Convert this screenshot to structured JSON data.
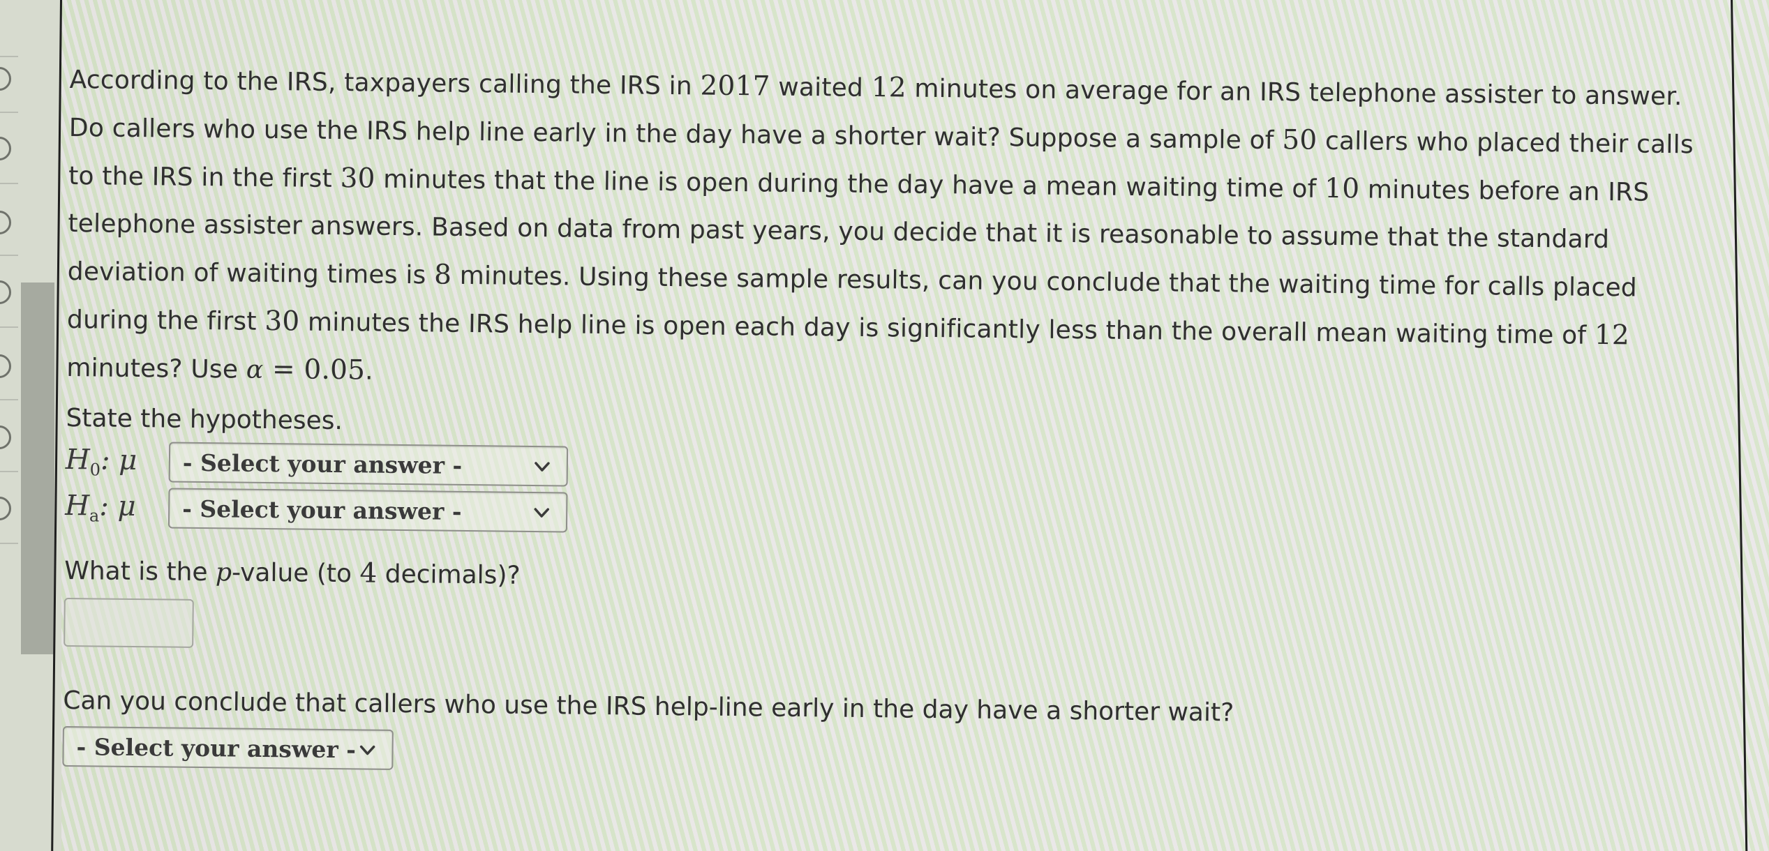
{
  "question": {
    "segments": [
      {
        "t": "According to the IRS, taxpayers calling the IRS in "
      },
      {
        "n": "2017"
      },
      {
        "t": " waited "
      },
      {
        "n": "12"
      },
      {
        "t": " minutes on average for an IRS telephone assister to answer. Do callers who use the IRS help line early in the day have a shorter wait? Suppose a sample of "
      },
      {
        "n": "50"
      },
      {
        "t": " callers who placed their calls to the IRS in the first "
      },
      {
        "n": "30"
      },
      {
        "t": " minutes that the line is open during the day have a mean waiting time of "
      },
      {
        "n": "10"
      },
      {
        "t": " minutes before an IRS telephone assister answers. Based on data from past years, you decide that it is reasonable to assume that the standard deviation of waiting times is "
      },
      {
        "n": "8"
      },
      {
        "t": " minutes. Using these sample results, can you conclude that the waiting time for calls placed during the first "
      },
      {
        "n": "30"
      },
      {
        "t": " minutes the IRS help line is open each day is significantly less than the overall mean waiting time of "
      },
      {
        "n": "12"
      },
      {
        "t": " minutes? Use "
      },
      {
        "m": "α"
      },
      {
        "n": " = 0.05"
      },
      {
        "t": "."
      }
    ]
  },
  "hypotheses": {
    "label": "State the hypotheses.",
    "h0": {
      "symbol": "H",
      "sub": "0",
      "param": ": μ",
      "selected": "- Select your answer -"
    },
    "ha": {
      "symbol": "H",
      "sub": "a",
      "param": ": μ",
      "selected": "- Select your answer -"
    }
  },
  "pvalue": {
    "label_before": "What is the ",
    "label_var": "p",
    "label_mid": "-value (to ",
    "label_num": "4",
    "label_after": " decimals)?",
    "value": ""
  },
  "conclusion": {
    "label": "Can you conclude that callers who use the IRS help-line early in the day have a shorter wait?",
    "selected": "- Select your answer -"
  },
  "icons": {
    "dropdown": "chevron-down-icon",
    "nav_status": "circle-outline-icon"
  },
  "colors": {
    "text": "#2f2f2f",
    "select_border": "#8e8f8a",
    "scroll_thumb": "#a6aaa0",
    "panel_border": "#1f1f1f"
  }
}
